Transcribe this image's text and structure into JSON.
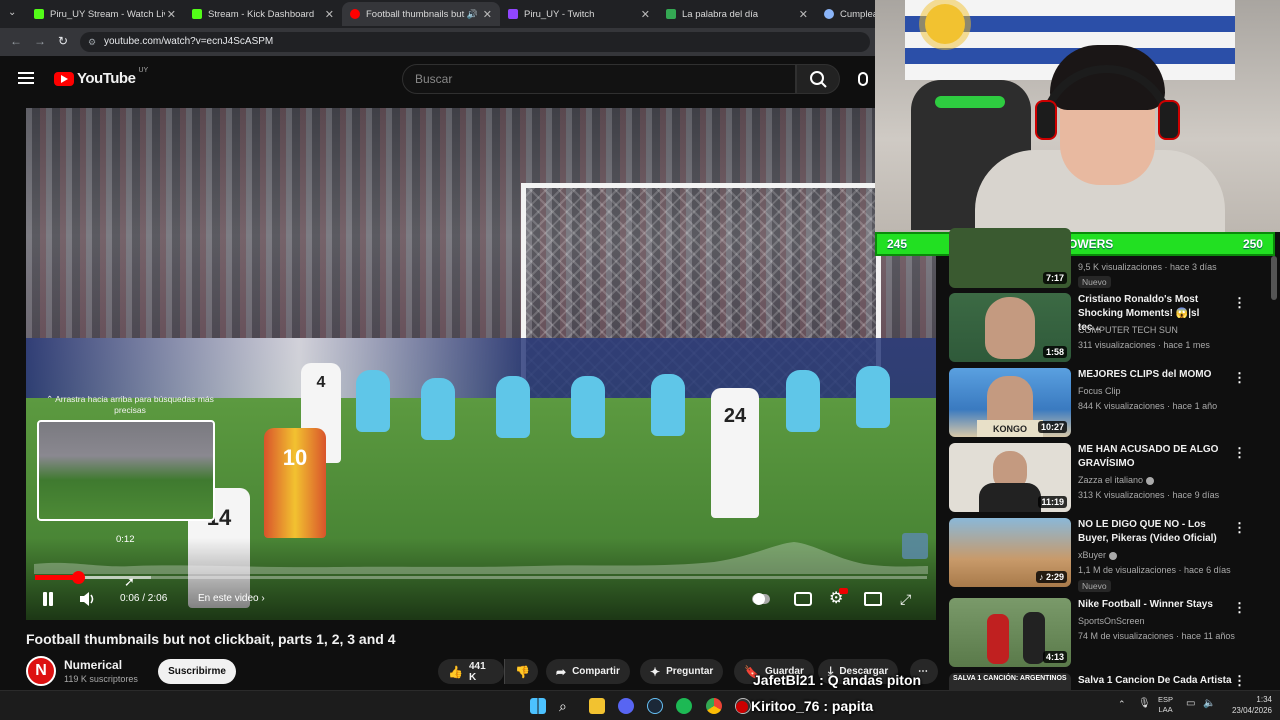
{
  "browser": {
    "tabs": [
      {
        "label": "Piru_UY Stream - Watch Live on",
        "color": "#53fc18",
        "active": false
      },
      {
        "label": "Stream - Kick Dashboard",
        "color": "#53fc18",
        "active": false
      },
      {
        "label": "Football thumbnails but no",
        "color": "#ff0000",
        "active": true
      },
      {
        "label": "Piru_UY - Twitch",
        "color": "#9146ff",
        "active": false
      },
      {
        "label": "La palabra del día",
        "color": "#34a853",
        "active": false
      },
      {
        "label": "Cumplea",
        "color": "#8ab4f8",
        "active": false
      }
    ],
    "url": "youtube.com/watch?v=ecnJ4ScASPM"
  },
  "youtube": {
    "logo_text": "YouTube",
    "country_code": "UY",
    "search_placeholder": "Buscar"
  },
  "player": {
    "drag_hint": "Arrastra hacia arriba para búsquedas más precisas",
    "preview_time": "0:12",
    "time_display": "0:06 / 2:06",
    "chapter_label": "En este video",
    "progress": 0.048,
    "loaded": 0.13,
    "hover_position": 0.1,
    "jersey_numbers": [
      "4",
      "24",
      "10",
      "14"
    ]
  },
  "video": {
    "title": "Football thumbnails but not clickbait, parts 1, 2, 3 and 4",
    "channel_name": "Numerical",
    "channel_initial": "N",
    "subscribers": "119 K suscriptores",
    "subscribe_label": "Suscribirme",
    "likes": "441 K",
    "share_label": "Compartir",
    "ask_label": "Preguntar",
    "save_label": "Guardar",
    "download_label": "Descargar"
  },
  "stream_overlay": {
    "followers_current": "245",
    "followers_label": "FOLLOWERS",
    "followers_goal": "250",
    "chat": [
      {
        "user": "JafetBl21",
        "message": ": Q andas piton"
      },
      {
        "user": "Kiritoo_76",
        "message": ": papita"
      }
    ]
  },
  "recommendations": [
    {
      "title": "",
      "channel": "",
      "meta": "9,5 K visualizaciones · hace 3 días",
      "duration": "7:17",
      "badge": "Nuevo",
      "thumb": "#3a5a30"
    },
    {
      "title": "Cristiano Ronaldo's Most Shocking Moments! 😱|sl tec...",
      "channel": "COMPUTER TECH SUN",
      "meta": "311 visualizaciones · hace 1 mes",
      "duration": "1:58",
      "badge": "",
      "thumb": "#2f5a3a"
    },
    {
      "title": "MEJORES CLIPS del MOMO",
      "channel": "Focus Clip",
      "meta": "844 K visualizaciones · hace 1 año",
      "duration": "10:27",
      "badge": "",
      "thumb": "#3a7ac0"
    },
    {
      "title": "ME HAN ACUSADO DE ALGO GRAVÍSIMO",
      "channel": "Zazza el italiano",
      "meta": "313 K visualizaciones · hace 9 días",
      "duration": "11:19",
      "badge": "",
      "thumb": "#d8d4cc"
    },
    {
      "title": "NO LE DIGO QUE NO - Los Buyer, Pikeras (Video Oficial)",
      "channel": "xBuyer",
      "meta": "1,1 M de visualizaciones · hace 6 días",
      "duration": "2:29",
      "badge": "Nuevo",
      "thumb": "#c89a6a"
    },
    {
      "title": "Nike Football - Winner Stays",
      "channel": "SportsOnScreen",
      "meta": "74 M de visualizaciones · hace 11 años",
      "duration": "4:13",
      "badge": "",
      "thumb": "#5a7a4a"
    },
    {
      "title": "Salva 1 Cancion De Cada Artista",
      "channel": "",
      "meta": "",
      "duration": "",
      "badge": "",
      "thumb": "#2a2a2a",
      "thumb_text": "SALVA 1 CANCIÓN: ARGENTINOS"
    }
  ],
  "taskbar": {
    "lang_top": "ESP",
    "lang_bottom": "LAA",
    "time": "1:34",
    "date": "23/04/2026"
  }
}
